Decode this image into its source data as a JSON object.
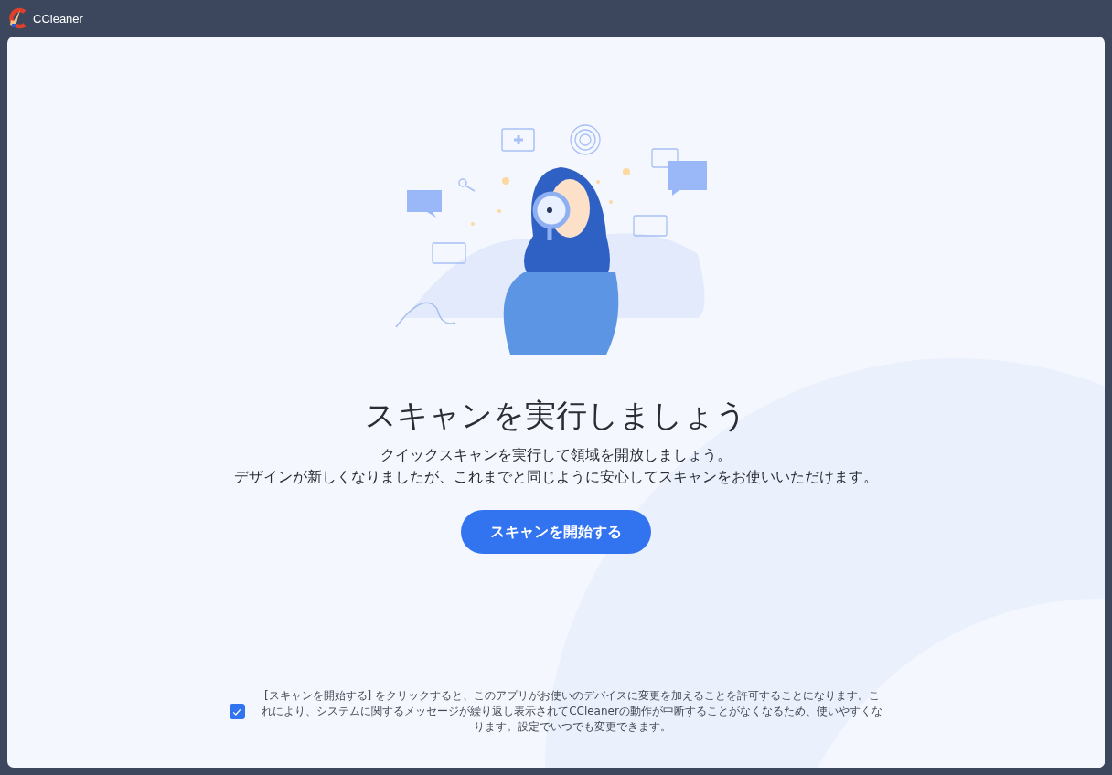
{
  "window": {
    "title": "CCleaner"
  },
  "main": {
    "heading": "スキャンを実行しましょう",
    "description": [
      "クイックスキャンを実行して領域を開放しましょう。",
      "デザインが新しくなりましたが、これまでと同じように安心してスキャンをお使いいただけます。"
    ],
    "button": "スキャンを開始する"
  },
  "consent": {
    "checked": true,
    "text": "[スキャンを開始する] をクリックすると、このアプリがお使いのデバイスに変更を加えることを許可することになります。これにより、システムに関するメッセージが繰り返し表示されてCCleanerの動作が中断することがなくなるため、使いやすくなります。設定でいつでも変更できます。"
  }
}
